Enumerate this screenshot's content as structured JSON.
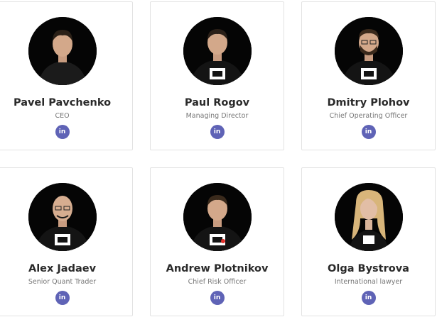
{
  "team": {
    "members": [
      {
        "name": "Pavel Pavchenko",
        "role": "CEO",
        "hair": "#2a2017",
        "shirt": "#1b1b1b",
        "linkedin_icon": "in"
      },
      {
        "name": "Paul Rogov",
        "role": "Managing Director",
        "hair": "#2b2018",
        "shirt": "#141414",
        "linkedin_icon": "in"
      },
      {
        "name": "Dmitry Plohov",
        "role": "Chief Operating Officer",
        "hair": "#3b2a1c",
        "shirt": "#141414",
        "linkedin_icon": "in"
      },
      {
        "name": "Alex Jadaev",
        "role": "Senior Quant Trader",
        "hair": "#1a1a1a",
        "shirt": "#141414",
        "linkedin_icon": "in"
      },
      {
        "name": "Andrew Plotnikov",
        "role": "Chief Risk Officer",
        "hair": "#3a2a1c",
        "shirt": "#141414",
        "linkedin_icon": "in"
      },
      {
        "name": "Olga Bystrova",
        "role": "International lawyer",
        "hair": "#d8b57a",
        "shirt": "#141414",
        "linkedin_icon": "in"
      }
    ]
  },
  "colors": {
    "linkedin": "#5f63b6",
    "card_border": "#e2e2e2",
    "name_text": "#2a2a2a",
    "role_text": "#777777"
  }
}
